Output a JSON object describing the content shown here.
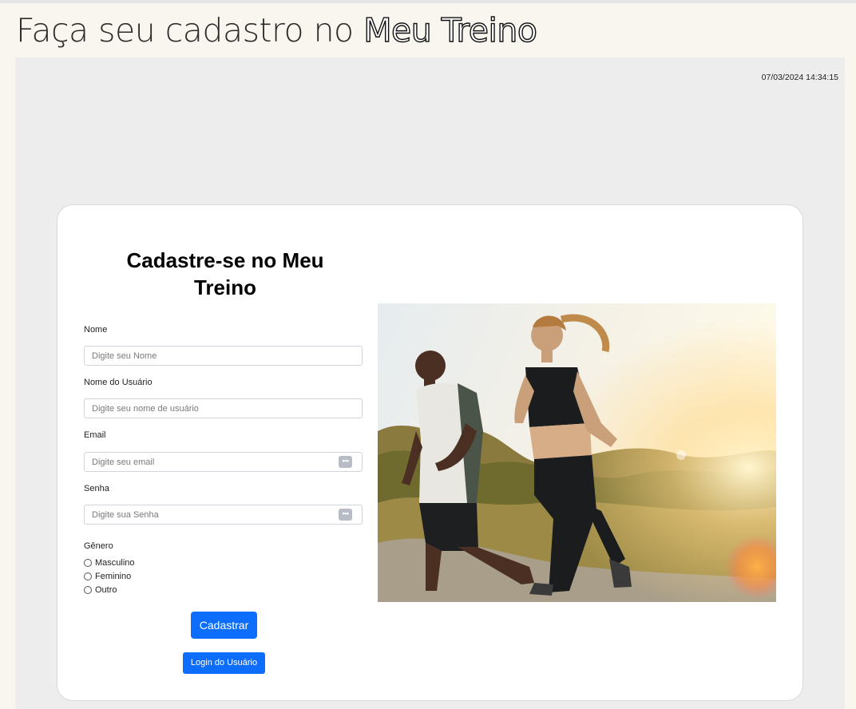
{
  "header": {
    "title_prefix": "Faça seu cadastro no ",
    "title_brand": "Meu Treino"
  },
  "datetime": "07/03/2024 14:34:15",
  "form": {
    "title_prefix": "Cadastre-se no ",
    "title_brand": "Meu Treino",
    "fields": [
      {
        "label": "Nome",
        "placeholder": "Digite seu Nome",
        "value": ""
      },
      {
        "label": "Nome do Usuário",
        "placeholder": "Digite seu nome de usuário",
        "value": ""
      },
      {
        "label": "Email",
        "placeholder": "Digite seu email",
        "value": ""
      },
      {
        "label": "Senha",
        "placeholder": "Digite sua Senha",
        "value": ""
      }
    ],
    "field_icon": "password-manager-icon",
    "gender": {
      "label": "Gênero",
      "options": [
        "Masculino",
        "Feminino",
        "Outro"
      ],
      "selected": null
    },
    "submit_label": "Cadastrar",
    "login_label": "Login do Usuário"
  },
  "photo": {
    "icon": "runners-photo"
  },
  "colors": {
    "background": "#f9f6ef",
    "panel": "#ededed",
    "primary_button": "#0d6efd"
  }
}
